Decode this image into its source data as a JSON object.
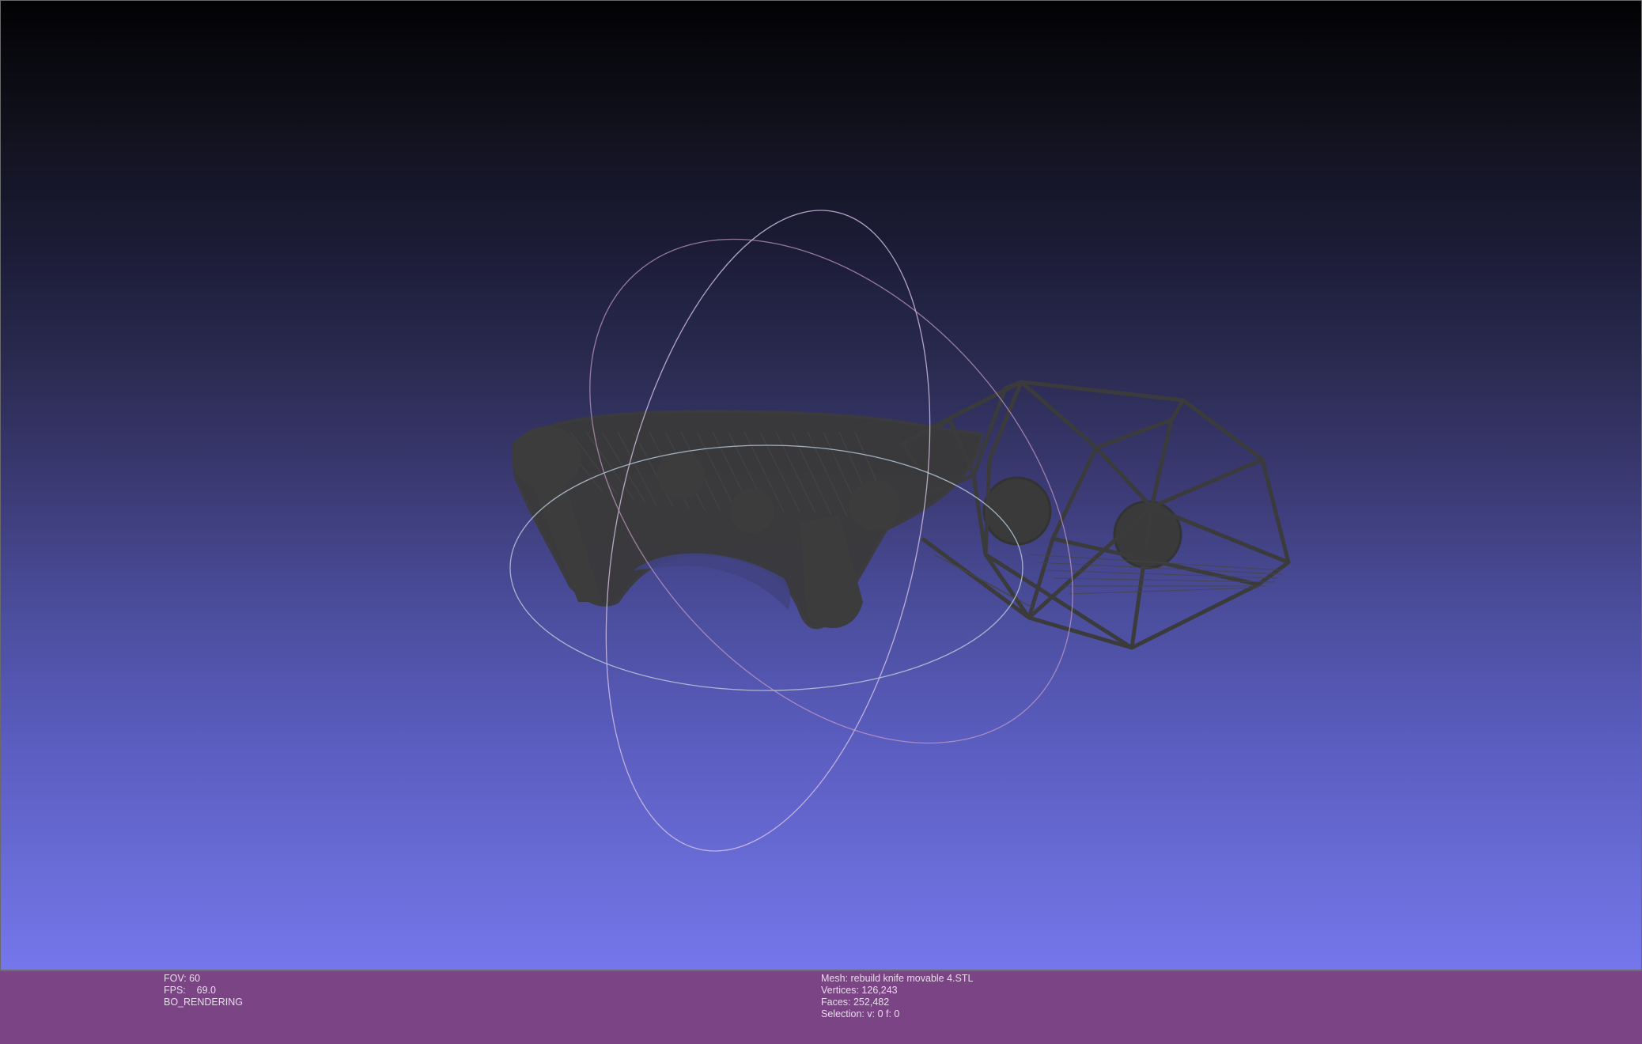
{
  "viewport": {
    "background_top": "#020204",
    "background_bottom": "#7576ea",
    "mesh_color": "#3c3c3c",
    "trackball_colors": [
      "#c8a8d8",
      "#d0c0e0",
      "#a8b8d8"
    ]
  },
  "info_bar": {
    "background": "#7b4585",
    "left": {
      "fov": "FOV: 60",
      "fps": "FPS:    69.0",
      "render_mode": "BO_RENDERING"
    },
    "right": {
      "mesh": "Mesh: rebuild knife movable 4.STL",
      "vertices": "Vertices: 126,243",
      "faces": "Faces: 252,482",
      "selection": "Selection: v: 0 f: 0"
    }
  }
}
